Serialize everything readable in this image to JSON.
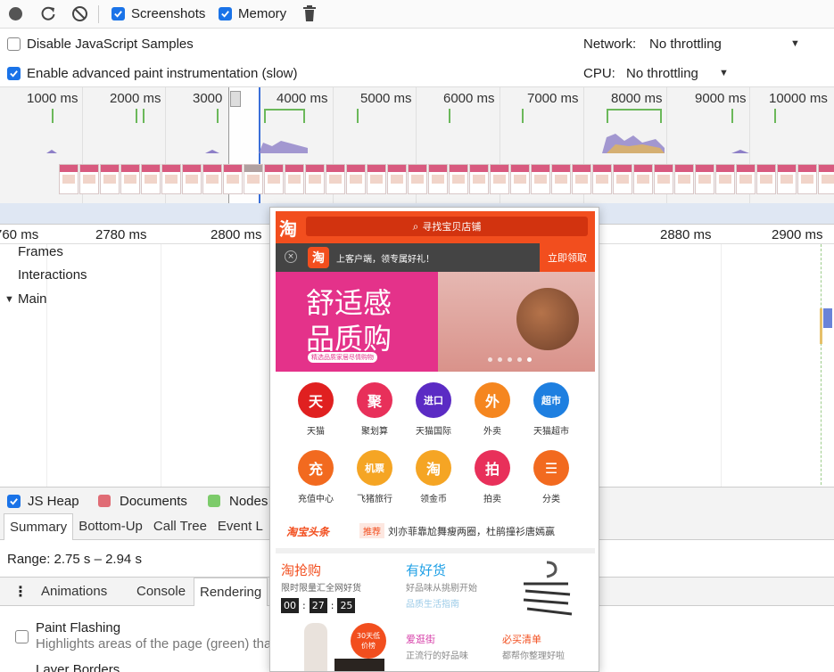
{
  "toolbar": {
    "screenshots_label": "Screenshots",
    "memory_label": "Memory"
  },
  "settings": {
    "disable_js_label": "Disable JavaScript Samples",
    "paint_label": "Enable advanced paint instrumentation (slow)",
    "network_label": "Network:",
    "network_value": "No throttling",
    "cpu_label": "CPU:",
    "cpu_value": "No throttling"
  },
  "overview": {
    "ticks": [
      "1000 ms",
      "2000 ms",
      "3000",
      "4000 ms",
      "5000 ms",
      "6000 ms",
      "7000 ms",
      "8000 ms",
      "9000 ms",
      "10000 ms"
    ]
  },
  "ruler": {
    "ticks": [
      "760 ms",
      "2780 ms",
      "2800 ms",
      "2880 ms",
      "2900 ms"
    ]
  },
  "tracks": {
    "frames": "Frames",
    "interactions": "Interactions",
    "main": "Main"
  },
  "legend": {
    "js_heap": "JS Heap",
    "documents": "Documents",
    "nodes": "Nodes"
  },
  "tabs1": [
    "Summary",
    "Bottom-Up",
    "Call Tree",
    "Event L"
  ],
  "range_text": "Range: 2.75 s – 2.94 s",
  "tabs2": [
    "Animations",
    "Console",
    "Rendering"
  ],
  "rendering": {
    "paint_title": "Paint Flashing",
    "paint_desc": "Highlights areas of the page (green) tha",
    "layer_borders": "Layer Borders"
  },
  "phone": {
    "logo": "淘",
    "search_placeholder": "寻找宝贝店铺",
    "promo_logo": "淘",
    "promo_text": "上客户端，领专属好礼！",
    "promo_button": "立即领取",
    "banner_line1": "舒适感",
    "banner_line2": "品质购",
    "banner_small": "精选品质家居尽情购物",
    "icons_row1": [
      {
        "glyph": "天",
        "label": "天猫",
        "color": "#e02020"
      },
      {
        "glyph": "聚",
        "label": "聚划算",
        "color": "#e8305a"
      },
      {
        "glyph": "进口",
        "label": "天猫国际",
        "color": "#5b2bc4"
      },
      {
        "glyph": "外",
        "label": "外卖",
        "color": "#f5861f"
      },
      {
        "glyph": "超市",
        "label": "天猫超市",
        "color": "#1e7fe0"
      }
    ],
    "icons_row2": [
      {
        "glyph": "充",
        "label": "充值中心",
        "color": "#f26a1f"
      },
      {
        "glyph": "机票",
        "label": "飞猪旅行",
        "color": "#f5a524"
      },
      {
        "glyph": "淘",
        "label": "领金币",
        "color": "#f5a524"
      },
      {
        "glyph": "拍",
        "label": "拍卖",
        "color": "#e8305a"
      },
      {
        "glyph": "☰",
        "label": "分类",
        "color": "#f26a1f"
      }
    ],
    "headline_logo": "淘宝头条",
    "headline_tag": "推荐",
    "headline_text": "刘亦菲靠尬舞瘦两圈，杜鹃撞衫唐嫣赢",
    "qiang_title": "淘抢购",
    "qiang_sub": "限时限量汇全网好货",
    "timer": [
      "00",
      "27",
      "25"
    ],
    "haohuo_title": "有好货",
    "haohuo_sub": "好品味从挑剔开始",
    "haohuo_link": "品质生活指南",
    "badge": "30天低价榜",
    "aiguang_title": "爱逛街",
    "aiguang_sub": "正流行的好品味",
    "bimai_title": "必买清单",
    "bimai_sub": "都帮你整理好啦"
  }
}
